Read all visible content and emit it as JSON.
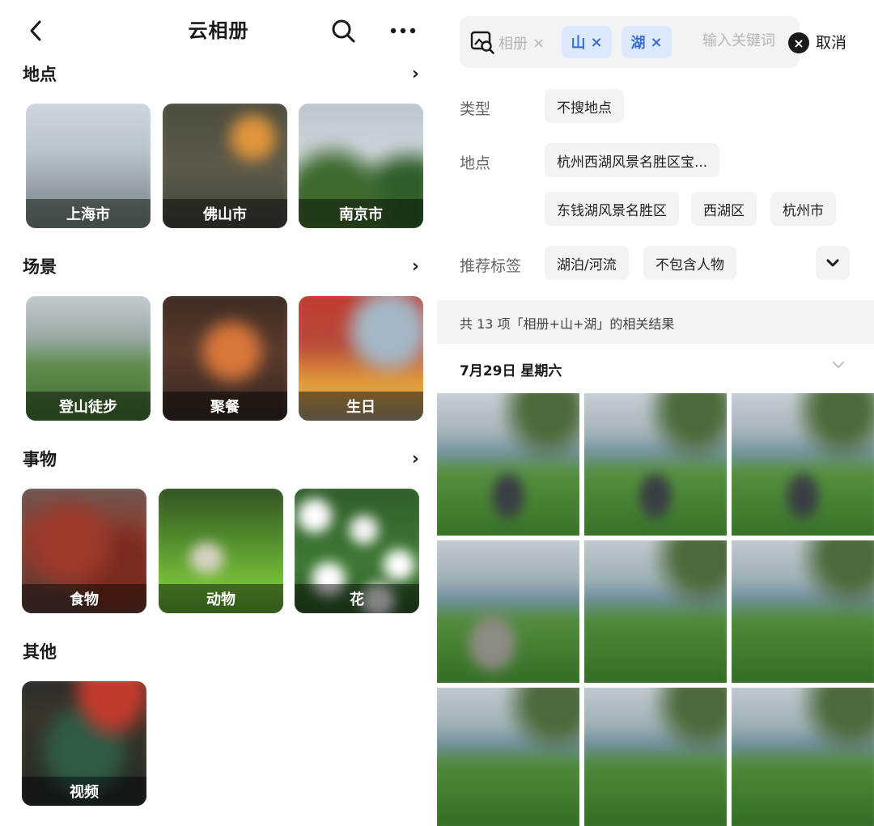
{
  "left": {
    "title": "云相册",
    "sections": [
      {
        "title": "地点",
        "chevron": "›",
        "items": [
          {
            "label": "上海市"
          },
          {
            "label": "佛山市"
          },
          {
            "label": "南京市"
          }
        ]
      },
      {
        "title": "场景",
        "chevron": "›",
        "items": [
          {
            "label": "登山徒步"
          },
          {
            "label": "聚餐"
          },
          {
            "label": "生日"
          }
        ]
      },
      {
        "title": "事物",
        "chevron": "›",
        "items": [
          {
            "label": "食物"
          },
          {
            "label": "动物"
          },
          {
            "label": "花"
          }
        ]
      },
      {
        "title": "其他",
        "items": [
          {
            "label": "视频"
          }
        ]
      }
    ]
  },
  "right": {
    "search": {
      "album_chip": "相册",
      "album_chip_close": "×",
      "chips": [
        {
          "label": "山",
          "close": "×"
        },
        {
          "label": "湖",
          "close": "×"
        }
      ],
      "placeholder": "输入关键词",
      "clear": "×",
      "cancel": "取消"
    },
    "filters": {
      "type_label": "类型",
      "type_chips": [
        "不搜地点"
      ],
      "place_label": "地点",
      "place_chips": [
        "杭州西湖风景名胜区宝...",
        "东钱湖风景名胜区",
        "西湖区",
        "杭州市"
      ],
      "tags_label": "推荐标签",
      "tag_chips": [
        "湖泊/河流",
        "不包含人物"
      ]
    },
    "results_text": "共 13 项「相册+山+湖」的相关结果",
    "date_header": "7月29日 星期六",
    "photo_count_visible": 9
  },
  "colors": {
    "accent_chip_bg": "#dce8fb",
    "accent_chip_text": "#3a6ed8",
    "chip_bg": "#f2f3f5",
    "label_gray": "#666666"
  },
  "icons": [
    "back-arrow-icon",
    "search-icon",
    "more-icon",
    "chevron-right-icon",
    "image-search-icon",
    "close-x-icon",
    "clear-icon",
    "chevron-down-icon"
  ]
}
